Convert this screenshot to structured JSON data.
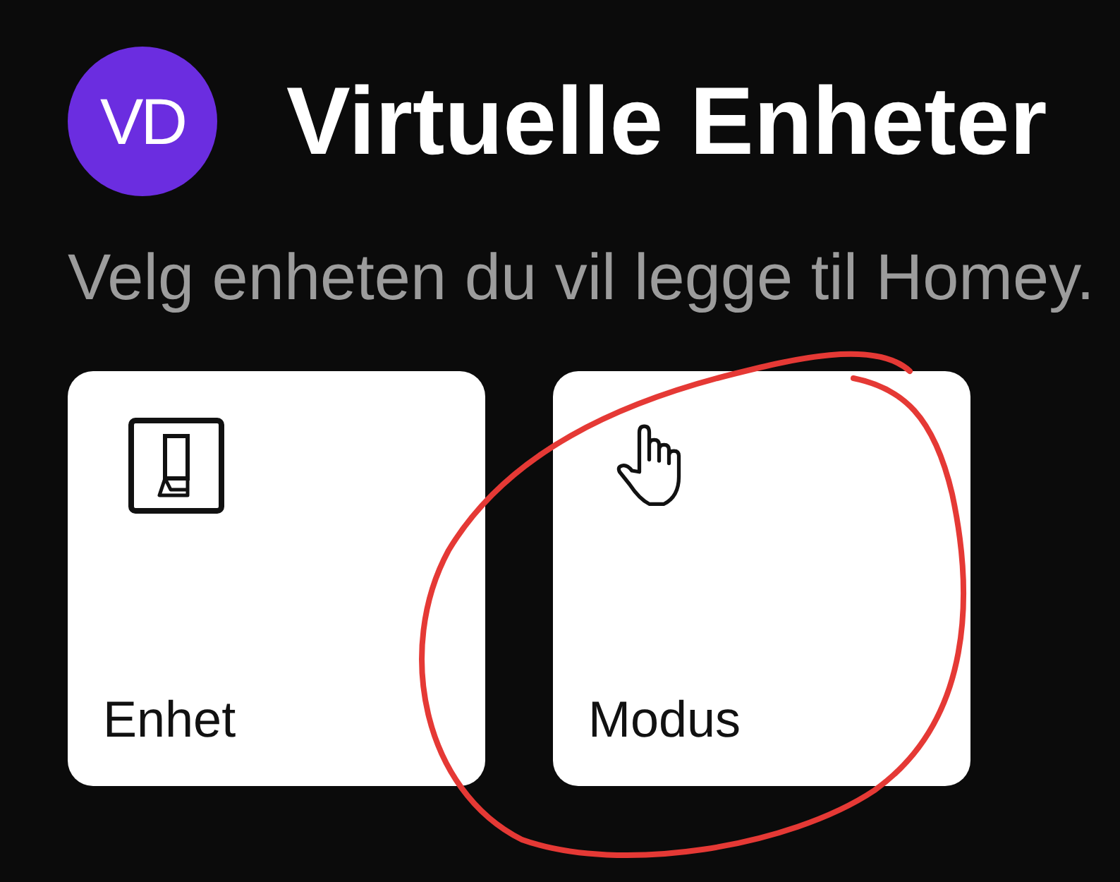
{
  "header": {
    "logo_text": "VD",
    "title": "Virtuelle Enheter"
  },
  "subtitle": "Velg enheten du vil legge til Homey.",
  "cards": [
    {
      "kind": "switch",
      "label": "Enhet"
    },
    {
      "kind": "hand",
      "label": "Modus"
    }
  ]
}
